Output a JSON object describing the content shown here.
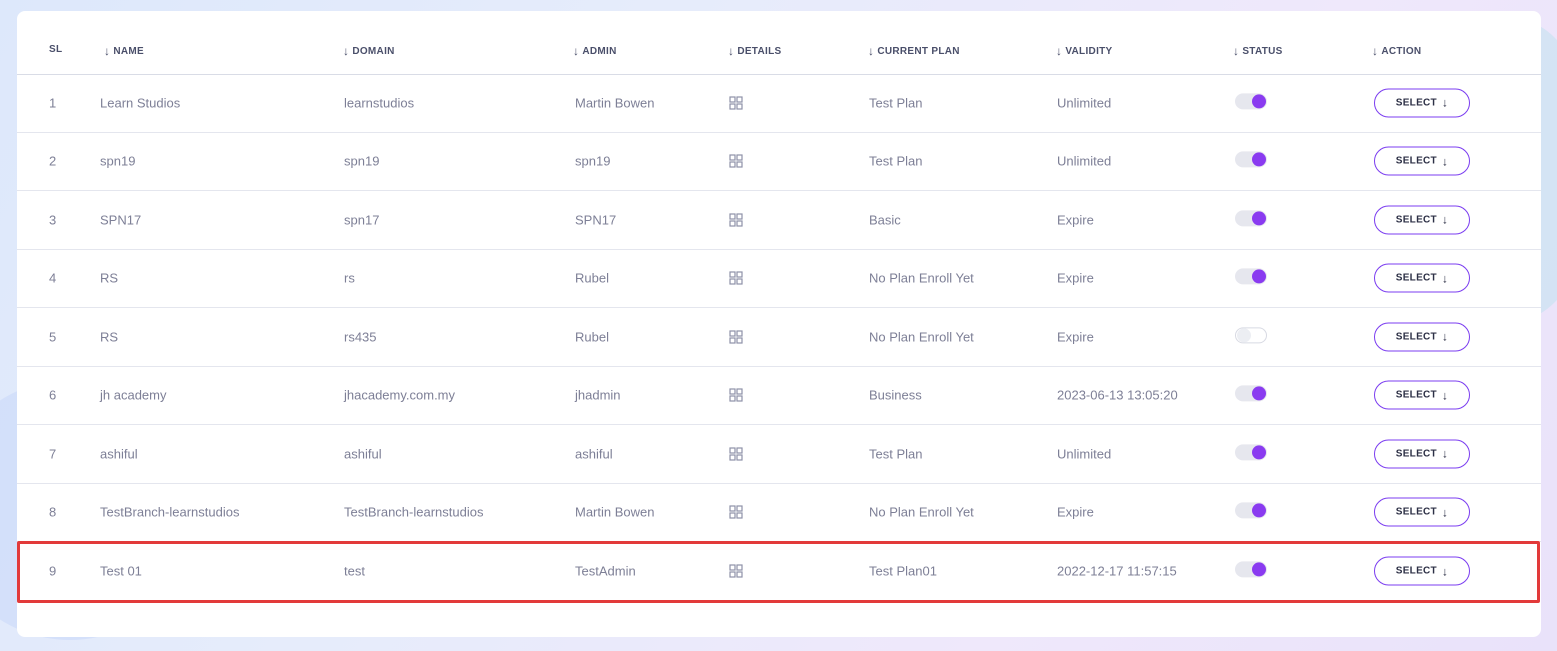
{
  "table": {
    "headers": {
      "sl": "SL",
      "name": "NAME",
      "domain": "DOMAIN",
      "admin": "ADMIN",
      "details": "DETAILS",
      "current_plan": "CURRENT PLAN",
      "validity": "VALIDITY",
      "status": "STATUS",
      "action": "ACTION"
    },
    "sort_icon": "arrow-down-icon",
    "details_icon": "grid-icon",
    "action_label": "SELECT",
    "rows": [
      {
        "sl": "1",
        "name": "Learn Studios",
        "domain": "learnstudios",
        "admin": "Martin Bowen",
        "plan": "Test Plan",
        "validity": "Unlimited",
        "status_on": true
      },
      {
        "sl": "2",
        "name": "spn19",
        "domain": "spn19",
        "admin": "spn19",
        "plan": "Test Plan",
        "validity": "Unlimited",
        "status_on": true
      },
      {
        "sl": "3",
        "name": "SPN17",
        "domain": "spn17",
        "admin": "SPN17",
        "plan": "Basic",
        "validity": "Expire",
        "status_on": true
      },
      {
        "sl": "4",
        "name": "RS",
        "domain": "rs",
        "admin": "Rubel",
        "plan": "No Plan Enroll Yet",
        "validity": "Expire",
        "status_on": true
      },
      {
        "sl": "5",
        "name": "RS",
        "domain": "rs435",
        "admin": "Rubel",
        "plan": "No Plan Enroll Yet",
        "validity": "Expire",
        "status_on": false
      },
      {
        "sl": "6",
        "name": "jh academy",
        "domain": "jhacademy.com.my",
        "admin": "jhadmin",
        "plan": "Business",
        "validity": "2023-06-13 13:05:20",
        "status_on": true
      },
      {
        "sl": "7",
        "name": "ashiful",
        "domain": "ashiful",
        "admin": "ashiful",
        "plan": "Test Plan",
        "validity": "Unlimited",
        "status_on": true
      },
      {
        "sl": "8",
        "name": "TestBranch-learnstudios",
        "domain": "TestBranch-learnstudios",
        "admin": "Martin Bowen",
        "plan": "No Plan Enroll Yet",
        "validity": "Expire",
        "status_on": true
      },
      {
        "sl": "9",
        "name": "Test 01",
        "domain": "test",
        "admin": "TestAdmin",
        "plan": "Test Plan01",
        "validity": "2022-12-17 11:57:15",
        "status_on": true
      }
    ],
    "highlighted_row": "9"
  },
  "colors": {
    "accent": "#8a3bf0",
    "button_border": "#7b3df0",
    "highlight": "#e23a3a",
    "text_muted": "#7d7f96",
    "header_text": "#4a4f6a"
  }
}
